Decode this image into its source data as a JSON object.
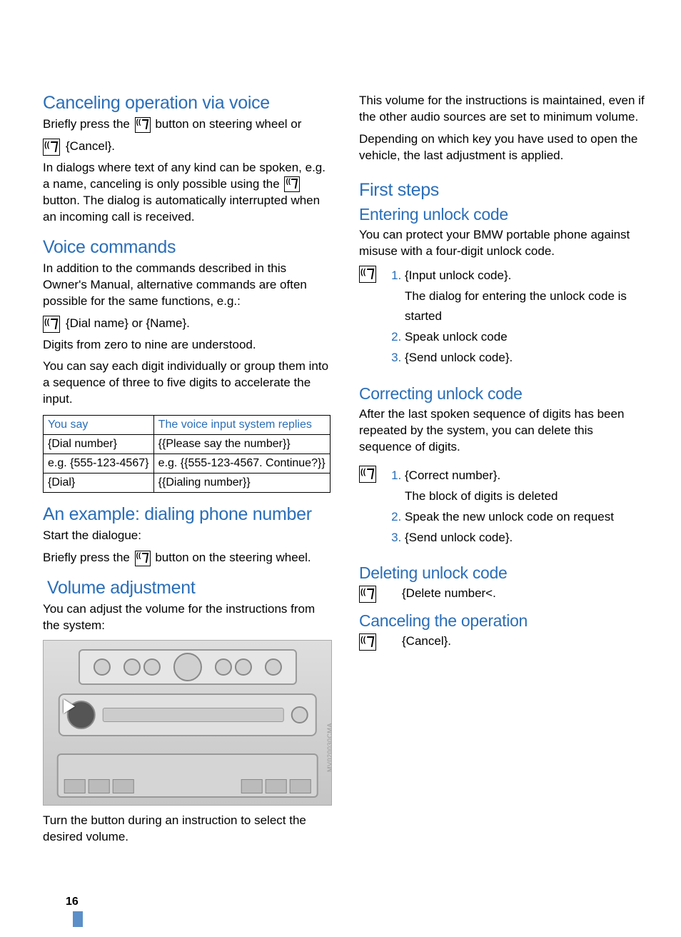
{
  "page_number": "16",
  "left": {
    "h_cancel": "Canceling operation via voice",
    "cancel_p1a": "Briefly press the ",
    "cancel_p1b": " button on steering wheel or",
    "cancel_cmd": "{Cancel}.",
    "cancel_p2": "In dialogs where text of any kind can be spoken, e.g. a name, canceling is only possible using the ",
    "cancel_p2b": " button. The dialog is automatically interrupted when an incoming call is received.",
    "h_voice": "Voice commands",
    "voice_p1": "In addition to the commands described in this Owner's Manual, alternative commands are often possible for the same functions, e.g.:",
    "voice_cmd": "{Dial name} or {Name}.",
    "voice_p2": "Digits from zero to nine are understood.",
    "voice_p3": "You can say each digit individually or group them into a sequence of three to five digits to accelerate the input.",
    "table": {
      "h1": "You say",
      "h2": "The voice input system replies",
      "r1c1": "{Dial number}",
      "r1c2": "{{Please say the number}}",
      "r2c1": "e.g. {555-123-4567}",
      "r2c2": "e.g. {{555-123-4567. Continue?}}",
      "r3c1": "{Dial}",
      "r3c2": "{{Dialing number}}"
    },
    "h_example": "An example: dialing phone number",
    "ex_p1": "Start the dialogue:",
    "ex_p2a": "Briefly press the ",
    "ex_p2b": " button on the steering wheel.",
    "h_volume": "Volume adjustment",
    "vol_p1": "You can adjust the volume for the instructions from the system:",
    "vol_p2": "Turn the button during an instruction to select the desired volume.",
    "img_code": "MV020030CMA"
  },
  "right": {
    "intro_p1": "This volume for the instructions is maintained, even if the other audio sources are set to minimum volume.",
    "intro_p2": "Depending on which key you have used to open the vehicle, the last adjustment is applied.",
    "h_first": "First steps",
    "h_entering": "Entering unlock code",
    "enter_p1": "You can protect your BMW portable phone against misuse with a four-digit unlock code.",
    "enter_ol": {
      "i1": "{Input unlock code}.",
      "i1b": "The dialog for entering the unlock code is started",
      "i2": "Speak unlock code",
      "i3": "{Send unlock code}."
    },
    "h_correct": "Correcting unlock code",
    "correct_p1": "After the last spoken sequence of digits has been repeated by the system, you can delete this sequence of digits.",
    "correct_ol": {
      "i1": "{Correct number}.",
      "i1b": "The block of digits is deleted",
      "i2": "Speak the new unlock code on request",
      "i3": "{Send unlock code}."
    },
    "h_delete": "Deleting unlock code",
    "delete_cmd": "{Delete number<.",
    "h_cancelop": "Canceling the operation",
    "cancelop_cmd": "{Cancel}."
  }
}
